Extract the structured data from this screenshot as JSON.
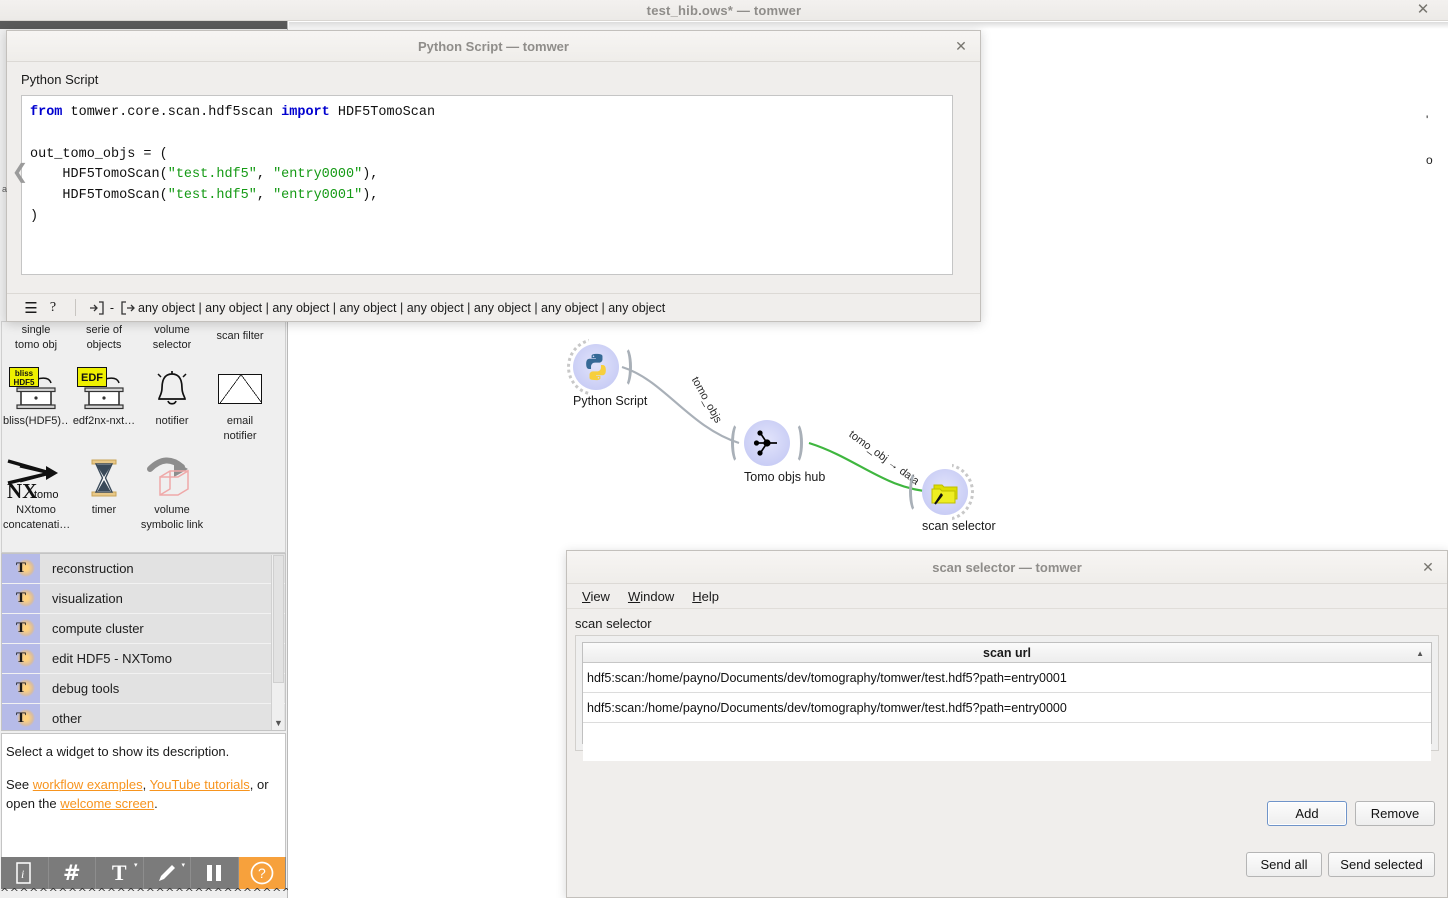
{
  "main_window": {
    "title": "test_hib.ows* — tomwer",
    "close_icon": "close-icon",
    "close_glyph": "✕"
  },
  "sidebar": {
    "collapse_glyph": "❮",
    "hidden_label": "a",
    "widget_grid": [
      {
        "label_line1": "single",
        "label_line2": "tomo obj",
        "icon": "single-tomo-obj-icon"
      },
      {
        "label_line1": "serie of",
        "label_line2": "objects",
        "icon": "serie-of-objects-icon"
      },
      {
        "label_line1": "volume",
        "label_line2": "selector",
        "icon": "volume-selector-icon"
      },
      {
        "label_line1": "scan filter",
        "label_line2": "",
        "icon": "scan-filter-icon"
      },
      {
        "label_line1": "bliss(HDF5)…",
        "label_line2": "",
        "icon": "bliss-hdf5-icon",
        "tag": "bliss\nHDF5"
      },
      {
        "label_line1": "edf2nx-nxt…",
        "label_line2": "",
        "icon": "edf2nx-icon",
        "tag": "EDF"
      },
      {
        "label_line1": "notifier",
        "label_line2": "",
        "icon": "bell-icon"
      },
      {
        "label_line1": "email",
        "label_line2": "notifier",
        "icon": "envelope-icon"
      },
      {
        "label_line1": "NXtomo",
        "label_line2": "concatenati…",
        "icon": "nxtomo-concatenate-icon"
      },
      {
        "label_line1": "timer",
        "label_line2": "",
        "icon": "hourglass-icon"
      },
      {
        "label_line1": "volume",
        "label_line2": "symbolic link",
        "icon": "volume-symbolic-link-icon"
      }
    ],
    "categories": [
      {
        "label": "reconstruction",
        "glyph": "T"
      },
      {
        "label": "visualization",
        "glyph": "T"
      },
      {
        "label": "compute cluster",
        "glyph": "T"
      },
      {
        "label": "edit HDF5 - NXTomo",
        "glyph": "T"
      },
      {
        "label": "debug tools",
        "glyph": "T"
      },
      {
        "label": "other",
        "glyph": "T"
      }
    ],
    "description": {
      "line1": "Select a widget to show its description.",
      "see_prefix": "See ",
      "link_workflow": "workflow examples",
      "comma": ", ",
      "link_youtube": "YouTube tutorials",
      "mid": ", or open the ",
      "link_welcome": "welcome screen",
      "period": "."
    },
    "toolbar": [
      {
        "name": "info-icon",
        "glyph": "🛈",
        "active": false
      },
      {
        "name": "grid-icon",
        "glyph": "#",
        "active": false
      },
      {
        "name": "text-tool-icon",
        "glyph": "T",
        "active": false,
        "caret": "▾"
      },
      {
        "name": "pen-tool-icon",
        "glyph": "✎",
        "active": false,
        "caret": "▾"
      },
      {
        "name": "pause-icon",
        "glyph": "❚❚",
        "active": false
      },
      {
        "name": "help-icon",
        "glyph": "?",
        "active": true
      }
    ]
  },
  "canvas": {
    "nodes": [
      {
        "id": "python-script",
        "label": "Python Script",
        "icon": "python-logo-icon"
      },
      {
        "id": "tomo-objs-hub",
        "label": "Tomo objs hub",
        "icon": "hub-icon"
      },
      {
        "id": "scan-selector",
        "label": "scan selector",
        "icon": "folder-arrow-icon"
      }
    ],
    "edges": [
      {
        "label": "tomo_objs",
        "color": "#a9b0b8"
      },
      {
        "label": "tomo_obj → data",
        "color": "#3fb63f"
      }
    ]
  },
  "python_dialog": {
    "title": "Python Script — tomwer",
    "close_glyph": "✕",
    "heading": "Python Script",
    "code_lines": [
      {
        "parts": [
          {
            "t": "from",
            "c": "kw"
          },
          {
            "t": " tomwer.core.scan.hdf5scan ",
            "c": ""
          },
          {
            "t": "import",
            "c": "kw"
          },
          {
            "t": " HDF5TomoScan",
            "c": ""
          }
        ]
      },
      {
        "parts": [
          {
            "t": "",
            "c": ""
          }
        ]
      },
      {
        "parts": [
          {
            "t": "out_tomo_objs = (",
            "c": ""
          }
        ]
      },
      {
        "parts": [
          {
            "t": "    HDF5TomoScan(",
            "c": ""
          },
          {
            "t": "\"test.hdf5\"",
            "c": "str"
          },
          {
            "t": ", ",
            "c": ""
          },
          {
            "t": "\"entry0000\"",
            "c": "str"
          },
          {
            "t": "),",
            "c": ""
          }
        ]
      },
      {
        "parts": [
          {
            "t": "    HDF5TomoScan(",
            "c": ""
          },
          {
            "t": "\"test.hdf5\"",
            "c": "str"
          },
          {
            "t": ", ",
            "c": ""
          },
          {
            "t": "\"entry0001\"",
            "c": "str"
          },
          {
            "t": "),",
            "c": ""
          }
        ]
      },
      {
        "parts": [
          {
            "t": ")",
            "c": ""
          }
        ]
      }
    ],
    "statusbar": {
      "menu_glyph": "☰",
      "help_glyph": "?",
      "input_glyph": "→]",
      "dash": "-",
      "output_glyph": "[→",
      "flow_text": "any object | any object | any object | any object | any object | any object | any object | any object"
    }
  },
  "scan_selector_dialog": {
    "title": "scan selector — tomwer",
    "close_glyph": "✕",
    "menus": [
      {
        "underlined": "V",
        "rest": "iew"
      },
      {
        "underlined": "W",
        "rest": "indow"
      },
      {
        "underlined": "H",
        "rest": "elp"
      }
    ],
    "section_label": "scan selector",
    "table": {
      "header": "scan url",
      "sort_glyph": "▲",
      "rows": [
        "hdf5:scan:/home/payno/Documents/dev/tomography/tomwer/test.hdf5?path=entry0001",
        "hdf5:scan:/home/payno/Documents/dev/tomography/tomwer/test.hdf5?path=entry0000"
      ]
    },
    "buttons": {
      "add": "Add",
      "remove": "Remove",
      "send_all": "Send all",
      "send_selected": "Send selected"
    }
  }
}
